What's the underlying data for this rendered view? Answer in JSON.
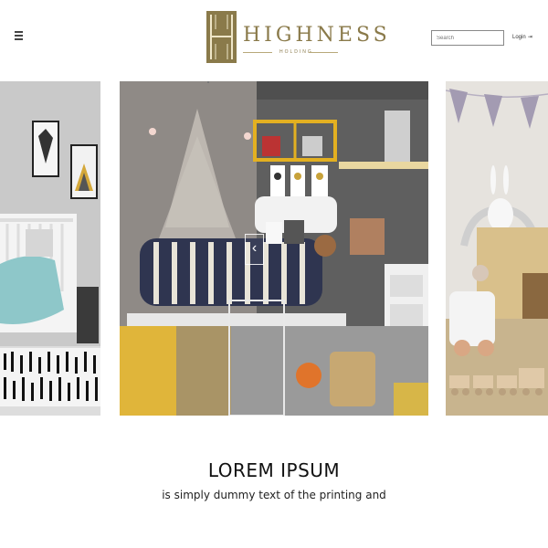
{
  "header": {
    "logo_text": "HIGHNESS",
    "logo_sub": "HOLDING",
    "search_placeholder": "Search",
    "login_label": "Login",
    "login_icon": "login-arrow-icon",
    "brand_color": "#8a7a4a"
  },
  "slider": {
    "prev_icon": "chevron-left-icon",
    "next_icon": "chevron-right-icon",
    "prev_glyph": "‹",
    "next_glyph": "›"
  },
  "caption": {
    "title": "LOREM IPSUM",
    "subtitle": "is simply dummy text of the printing and"
  }
}
